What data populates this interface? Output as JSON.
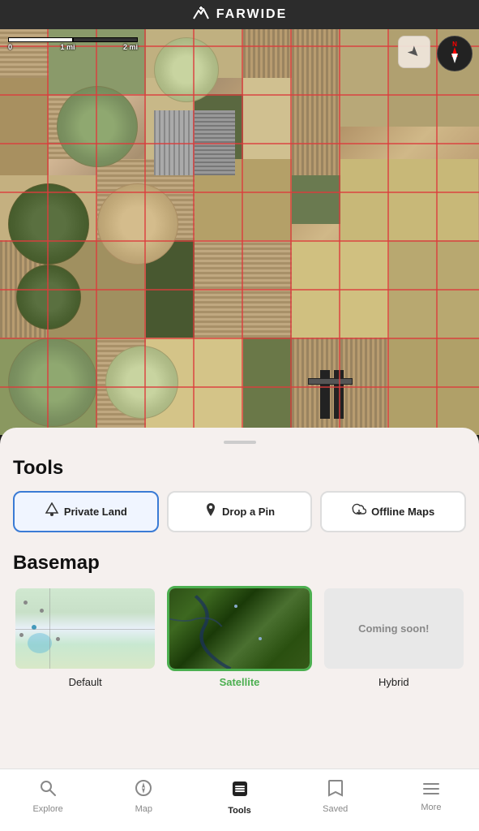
{
  "app": {
    "name": "FARWIDE",
    "logo_icon": "mountain-icon"
  },
  "map": {
    "scale": {
      "label_0": "0",
      "label_1": "1 mi",
      "label_2": "2 mi"
    },
    "location_button_icon": "location-arrow-icon",
    "compass_label": "N"
  },
  "bottom_sheet": {
    "tools_title": "Tools",
    "basemap_title": "Basemap",
    "tools": [
      {
        "id": "private-land",
        "label": "Private Land",
        "icon": "mountain-pin-icon",
        "active": true
      },
      {
        "id": "drop-pin",
        "label": "Drop a Pin",
        "icon": "pin-icon",
        "active": false
      },
      {
        "id": "offline-maps",
        "label": "Offline Maps",
        "icon": "cloud-download-icon",
        "active": false
      }
    ],
    "basemaps": [
      {
        "id": "default",
        "label": "Default",
        "selected": false
      },
      {
        "id": "satellite",
        "label": "Satellite",
        "selected": true
      },
      {
        "id": "hybrid",
        "label": "Hybrid",
        "selected": false,
        "coming_soon": "Coming soon!"
      }
    ]
  },
  "bottom_nav": {
    "items": [
      {
        "id": "explore",
        "label": "Explore",
        "icon": "search-icon",
        "active": false
      },
      {
        "id": "map",
        "label": "Map",
        "icon": "compass-icon",
        "active": false
      },
      {
        "id": "tools",
        "label": "Tools",
        "icon": "layers-icon",
        "active": true
      },
      {
        "id": "saved",
        "label": "Saved",
        "icon": "bookmark-icon",
        "active": false
      },
      {
        "id": "more",
        "label": "More",
        "icon": "menu-icon",
        "active": false
      }
    ]
  }
}
